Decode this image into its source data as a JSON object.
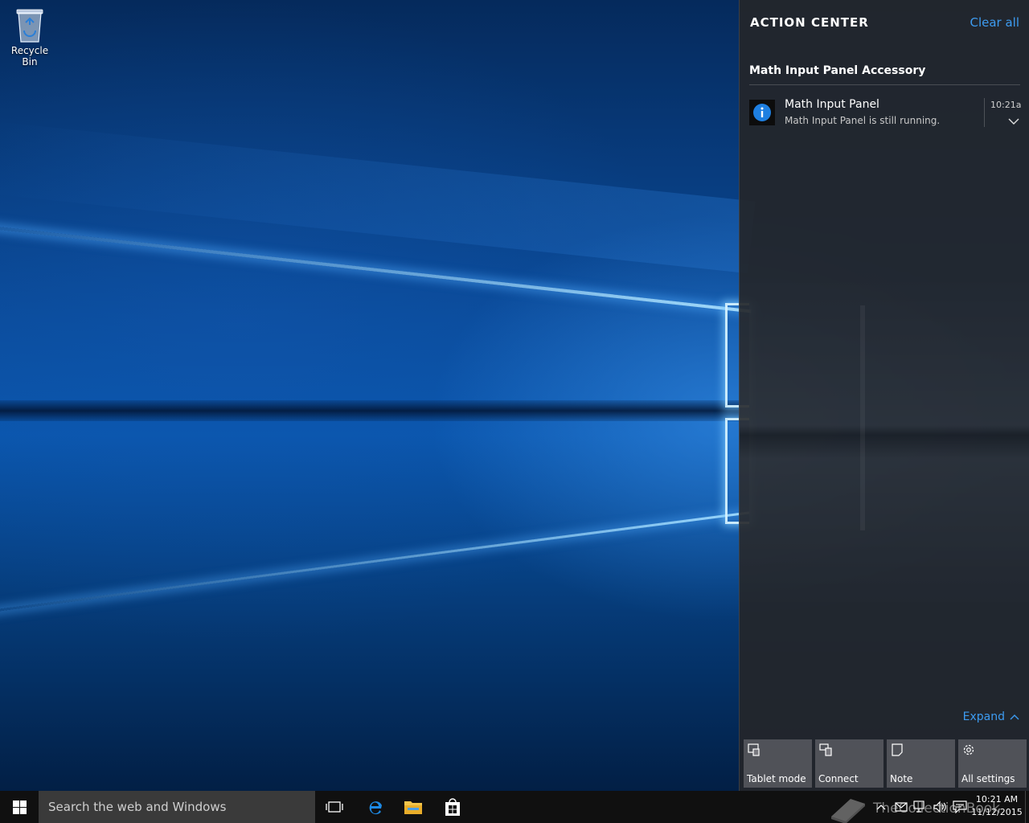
{
  "desktop": {
    "icons": [
      {
        "label": "Recycle Bin",
        "icon": "recycle-bin-icon"
      }
    ]
  },
  "action_center": {
    "title": "ACTION CENTER",
    "clear_all": "Clear all",
    "groups": [
      {
        "app": "Math Input Panel Accessory",
        "notifications": [
          {
            "title": "Math Input Panel",
            "body": "Math Input Panel is still running.",
            "time": "10:21a",
            "icon": "info-icon"
          }
        ]
      }
    ],
    "expand_label": "Expand",
    "quick_actions": [
      {
        "label": "Tablet mode",
        "icon": "tablet-mode-icon"
      },
      {
        "label": "Connect",
        "icon": "connect-icon"
      },
      {
        "label": "Note",
        "icon": "note-icon"
      },
      {
        "label": "All settings",
        "icon": "gear-icon"
      }
    ],
    "accent_color": "#3d9bf0"
  },
  "taskbar": {
    "search_placeholder": "Search the web and Windows",
    "pinned": [
      {
        "name": "Task View",
        "icon": "task-view-icon"
      },
      {
        "name": "Microsoft Edge",
        "icon": "edge-icon"
      },
      {
        "name": "File Explorer",
        "icon": "file-explorer-icon"
      },
      {
        "name": "Store",
        "icon": "store-icon"
      }
    ],
    "clock": {
      "time": "10:21 AM",
      "date": "11/12/2015"
    }
  },
  "watermark": "TheCollectionBook"
}
